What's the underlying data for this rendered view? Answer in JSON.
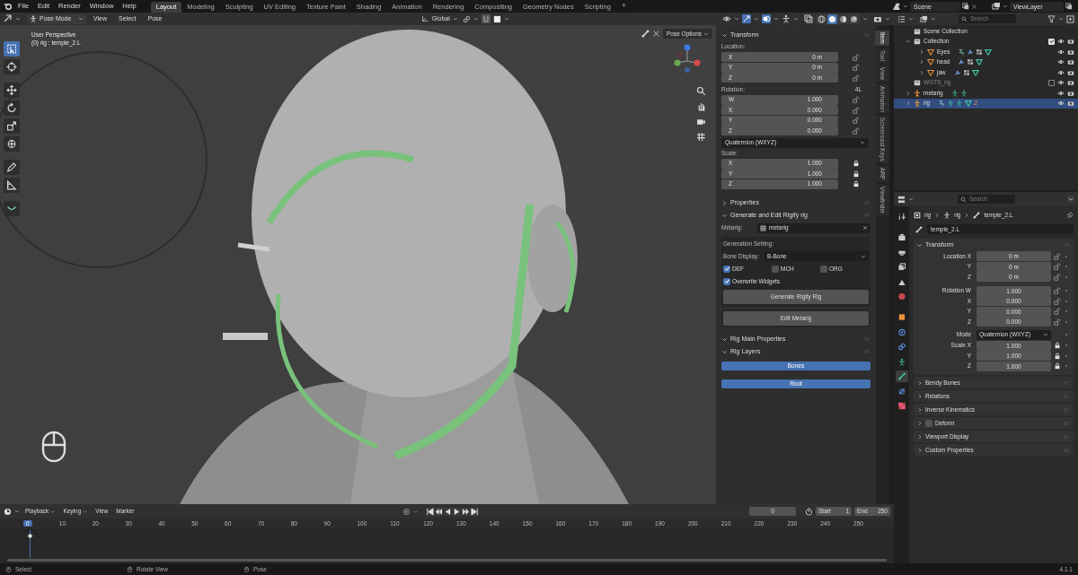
{
  "topbar": {
    "menus": [
      "File",
      "Edit",
      "Render",
      "Window",
      "Help"
    ],
    "workspaces": [
      {
        "label": "Layout",
        "selected": true
      },
      {
        "label": "Modeling",
        "selected": false
      },
      {
        "label": "Sculpting",
        "selected": false
      },
      {
        "label": "UV Editing",
        "selected": false
      },
      {
        "label": "Texture Paint",
        "selected": false
      },
      {
        "label": "Shading",
        "selected": false
      },
      {
        "label": "Animation",
        "selected": false
      },
      {
        "label": "Rendering",
        "selected": false
      },
      {
        "label": "Compositing",
        "selected": false
      },
      {
        "label": "Geometry Nodes",
        "selected": false
      },
      {
        "label": "Scripting",
        "selected": false
      }
    ],
    "add_workspace": "+",
    "scene": "Scene",
    "view_layer": "ViewLayer"
  },
  "viewport": {
    "mode": "Pose Mode",
    "menus": [
      "View",
      "Select",
      "Pose"
    ],
    "orientation": "Global",
    "pose_options": "Pose Options",
    "view_name": "User Perspective",
    "active": "(0) rig : temple_2.L",
    "shading": [
      {
        "kind": "wireframe",
        "selected": false
      },
      {
        "kind": "solid",
        "selected": true
      },
      {
        "kind": "material",
        "selected": false
      },
      {
        "kind": "rendered",
        "selected": false
      }
    ],
    "tools": [
      {
        "kind": "select",
        "selected": true
      },
      {
        "kind": "cursor",
        "selected": false
      },
      {
        "kind": "move",
        "selected": false
      },
      {
        "kind": "rotate",
        "selected": false
      },
      {
        "kind": "scale",
        "selected": false
      },
      {
        "kind": "transform",
        "selected": false
      },
      {
        "kind": "annotate",
        "selected": false
      },
      {
        "kind": "measure",
        "selected": false
      },
      {
        "kind": "bone",
        "selected": false
      }
    ]
  },
  "sidebar_tabs": [
    {
      "label": "Item",
      "selected": true
    },
    {
      "label": "Tool",
      "selected": false
    },
    {
      "label": "View",
      "selected": false
    },
    {
      "label": "Animation",
      "selected": false
    },
    {
      "label": "Screencast Keys",
      "selected": false
    },
    {
      "label": "ARP",
      "selected": false
    },
    {
      "label": "Viewfinder",
      "selected": false
    }
  ],
  "n_panel": {
    "transform": {
      "title": "Transform",
      "expanded": true,
      "location_label": "Location:",
      "location": [
        {
          "axis": "X",
          "value": "0 m",
          "locked": false
        },
        {
          "axis": "Y",
          "value": "0 m",
          "locked": false
        },
        {
          "axis": "Z",
          "value": "0 m",
          "locked": false
        }
      ],
      "rotation_label": "Rotation:",
      "rotation_lock": "4L",
      "rotation": [
        {
          "axis": "W",
          "value": "1.000",
          "locked": false
        },
        {
          "axis": "X",
          "value": "0.000",
          "locked": false
        },
        {
          "axis": "Y",
          "value": "0.000",
          "locked": false
        },
        {
          "axis": "Z",
          "value": "0.000",
          "locked": false
        }
      ],
      "mode": "Quaternion (WXYZ)",
      "scale_label": "Scale:",
      "scale": [
        {
          "axis": "X",
          "value": "1.000",
          "locked": true
        },
        {
          "axis": "Y",
          "value": "1.000",
          "locked": true
        },
        {
          "axis": "Z",
          "value": "1.000",
          "locked": true
        }
      ]
    },
    "properties": {
      "title": "Properties",
      "expanded": false
    },
    "rigify": {
      "title": "Generate and Edit Rigify rig",
      "expanded": true,
      "metarig_label": "Metarig:",
      "metarig": "metarig",
      "settings_title": "Generation Setting:",
      "bone_display_label": "Bone Display:",
      "bone_display": "B-Bone",
      "layers": [
        {
          "label": "DEF",
          "checked": true
        },
        {
          "label": "MCH",
          "checked": false
        },
        {
          "label": "ORG",
          "checked": false
        }
      ],
      "overwrite": {
        "label": "Overwrite Widgets",
        "checked": true
      },
      "generate": "Generate Rigify Rig",
      "edit": "Edit Metarig"
    },
    "rig_main": {
      "title": "Rig Main Properties",
      "expanded": true
    },
    "rig_layers": {
      "title": "Rig Layers",
      "expanded": true,
      "buttons": [
        {
          "label": "Bones",
          "selected": true
        },
        {
          "label": "Root",
          "selected": true
        }
      ]
    }
  },
  "outliner": {
    "search": "Search",
    "tree": [
      {
        "name": "Scene Collection",
        "kind": "scene_collection",
        "selected": false,
        "children": [
          {
            "name": "Collection",
            "kind": "collection",
            "expanded": true,
            "checked": true,
            "selected": false,
            "children": [
              {
                "name": "Eyes",
                "kind": "mesh",
                "expanded": false,
                "selected": false,
                "badges": [
                  {
                    "kind": "constraint"
                  },
                  {
                    "kind": "modifier"
                  },
                  {
                    "kind": "vertex_groups"
                  },
                  {
                    "kind": "mesh_data"
                  }
                ]
              },
              {
                "name": "head",
                "kind": "mesh",
                "expanded": false,
                "selected": false,
                "badges": [
                  {
                    "kind": "modifier"
                  },
                  {
                    "kind": "vertex_groups"
                  },
                  {
                    "kind": "mesh_data"
                  }
                ]
              },
              {
                "name": "jaw",
                "kind": "mesh",
                "expanded": false,
                "selected": false,
                "badges": [
                  {
                    "kind": "modifier"
                  },
                  {
                    "kind": "vertex_groups"
                  },
                  {
                    "kind": "mesh_data"
                  }
                ]
              }
            ]
          },
          {
            "name": "WGTS_rig",
            "kind": "collection",
            "checked": false,
            "selected": false
          },
          {
            "name": "metarig",
            "kind": "armature",
            "expanded": false,
            "selected": false,
            "badges": [
              {
                "kind": "pose"
              },
              {
                "kind": "armature_data"
              }
            ]
          },
          {
            "name": "rig",
            "kind": "armature",
            "expanded": false,
            "selected": true,
            "badges": [
              {
                "kind": "constraint"
              },
              {
                "kind": "pose"
              },
              {
                "kind": "armature_data"
              },
              {
                "kind": "mesh_data"
              }
            ],
            "count": "2"
          }
        ]
      }
    ]
  },
  "properties": {
    "search": "Search",
    "tabs": [
      {
        "kind": "tool",
        "selected": false
      },
      {
        "kind": "render",
        "selected": false
      },
      {
        "kind": "output",
        "selected": false
      },
      {
        "kind": "view_layer",
        "selected": false
      },
      {
        "kind": "scene",
        "selected": false
      },
      {
        "kind": "world",
        "selected": false
      },
      {
        "kind": "object",
        "selected": false
      },
      {
        "kind": "physics",
        "selected": false
      },
      {
        "kind": "constraints",
        "selected": false
      },
      {
        "kind": "armature",
        "selected": false
      },
      {
        "kind": "bone",
        "selected": true
      },
      {
        "kind": "bone_constraints",
        "selected": false
      },
      {
        "kind": "texture",
        "selected": false
      }
    ],
    "breadcrumb": [
      {
        "kind": "object",
        "label": "rig"
      },
      {
        "kind": "armature",
        "label": "rig"
      },
      {
        "kind": "bone",
        "label": "temple_2.L"
      }
    ],
    "bone_name": "temple_2.L",
    "transform": {
      "title": "Transform",
      "expanded": true,
      "rows": [
        {
          "label": "Location X",
          "value": "0 m",
          "locked": false
        },
        {
          "label": "Y",
          "value": "0 m",
          "locked": false
        },
        {
          "label": "Z",
          "value": "0 m",
          "locked": false
        },
        {
          "label": "Rotation W",
          "value": "1.000",
          "locked": false
        },
        {
          "label": "X",
          "value": "0.000",
          "locked": false
        },
        {
          "label": "Y",
          "value": "0.000",
          "locked": false
        },
        {
          "label": "Z",
          "value": "0.000",
          "locked": false
        }
      ],
      "mode_label": "Mode",
      "mode": "Quaternion (WXYZ)",
      "scale_rows": [
        {
          "label": "Scale X",
          "value": "1.000",
          "locked": true
        },
        {
          "label": "Y",
          "value": "1.000",
          "locked": true
        },
        {
          "label": "Z",
          "value": "1.000",
          "locked": true
        }
      ]
    },
    "panels": [
      {
        "title": "Bendy Bones",
        "kind": "plain",
        "expanded": false
      },
      {
        "title": "Relations",
        "kind": "plain",
        "expanded": false
      },
      {
        "title": "Inverse Kinematics",
        "kind": "plain",
        "expanded": false
      },
      {
        "title": "Deform",
        "kind": "toggle",
        "checked": false,
        "expanded": false
      },
      {
        "title": "Viewport Display",
        "kind": "plain",
        "expanded": false
      },
      {
        "title": "Custom Properties",
        "kind": "plain",
        "expanded": false
      }
    ]
  },
  "timeline": {
    "menus": [
      "Playback",
      "Keying",
      "View",
      "Marker"
    ],
    "frame": "0",
    "start_label": "Start",
    "start": "1",
    "end_label": "End",
    "end": "250",
    "ticks": [
      {
        "label": "0",
        "selected": true
      },
      {
        "label": "10",
        "selected": false
      },
      {
        "label": "20",
        "selected": false
      },
      {
        "label": "30",
        "selected": false
      },
      {
        "label": "40",
        "selected": false
      },
      {
        "label": "50",
        "selected": false
      },
      {
        "label": "60",
        "selected": false
      },
      {
        "label": "70",
        "selected": false
      },
      {
        "label": "80",
        "selected": false
      },
      {
        "label": "90",
        "selected": false
      },
      {
        "label": "100",
        "selected": false
      },
      {
        "label": "110",
        "selected": false
      },
      {
        "label": "120",
        "selected": false
      },
      {
        "label": "130",
        "selected": false
      },
      {
        "label": "140",
        "selected": false
      },
      {
        "label": "150",
        "selected": false
      },
      {
        "label": "160",
        "selected": false
      },
      {
        "label": "170",
        "selected": false
      },
      {
        "label": "180",
        "selected": false
      },
      {
        "label": "190",
        "selected": false
      },
      {
        "label": "200",
        "selected": false
      },
      {
        "label": "210",
        "selected": false
      },
      {
        "label": "220",
        "selected": false
      },
      {
        "label": "230",
        "selected": false
      },
      {
        "label": "240",
        "selected": false
      },
      {
        "label": "250",
        "selected": false
      }
    ]
  },
  "status_bar": {
    "hints": [
      "Select",
      "Rotate View",
      "Pose"
    ],
    "version": "4.1.1"
  }
}
